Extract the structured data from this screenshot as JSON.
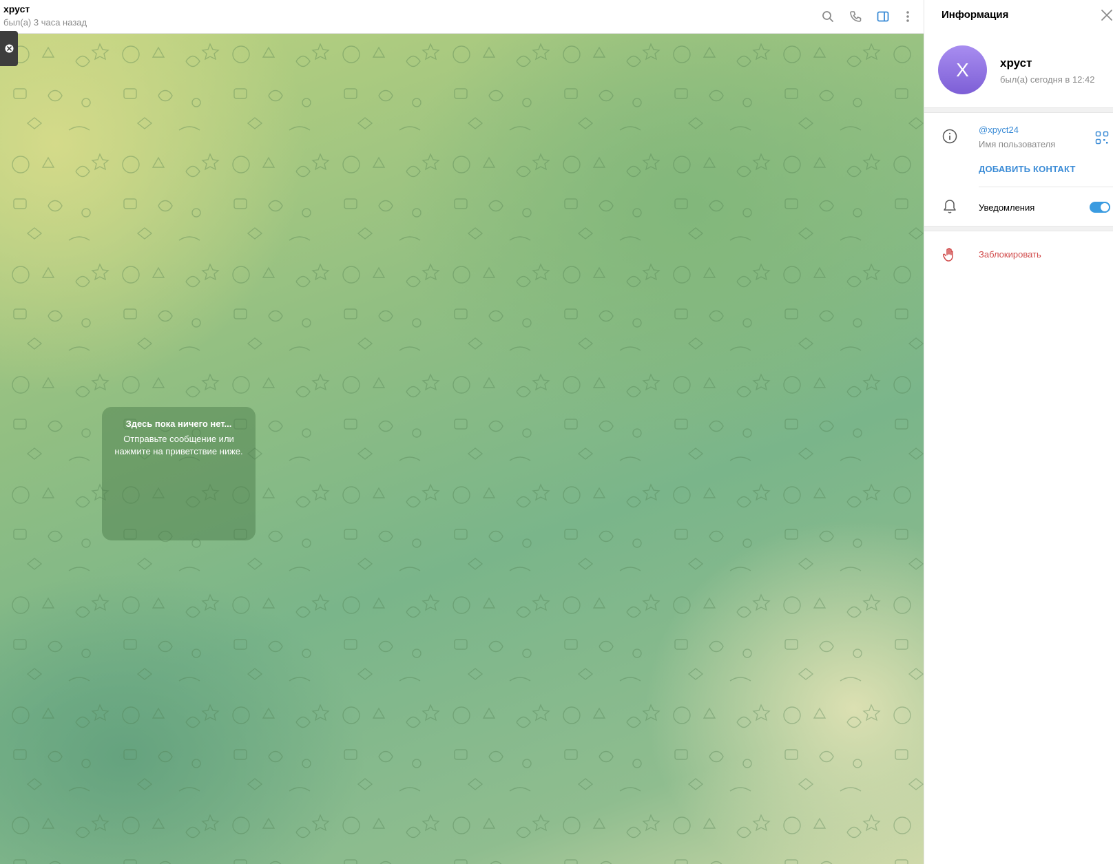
{
  "chat": {
    "title": "хруст",
    "status": "был(а) 3 часа назад",
    "empty": {
      "title": "Здесь пока ничего нет...",
      "subtitle": "Отправьте сообщение или нажмите на приветствие ниже."
    },
    "icons": [
      "search-icon",
      "phone-icon",
      "sidebar-toggle-icon",
      "more-icon",
      "close-icon"
    ],
    "colors": {
      "accent": "#3a8bd6",
      "status": "#8a8a8a"
    }
  },
  "info_panel": {
    "title": "Информация",
    "avatar_letter": "Х",
    "name": "хруст",
    "status": "был(а) сегодня в 12:42",
    "username": "@xpyct24",
    "username_label": "Имя пользователя",
    "add_contact": "ДОБАВИТЬ КОНТАКТ",
    "notifications_label": "Уведомления",
    "notifications_on": true,
    "block_label": "Заблокировать",
    "colors": {
      "avatar": "#8f73e3",
      "link": "#3a8bd6",
      "danger": "#d14b4b",
      "toggle": "#3a9be0"
    }
  }
}
